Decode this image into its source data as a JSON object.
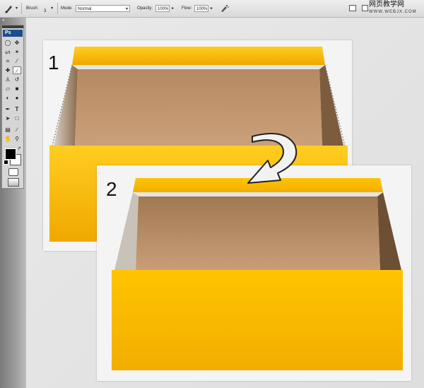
{
  "options_bar": {
    "brush_label": "Brush:",
    "brush_size": "3",
    "mode_label": "Mode:",
    "mode_value": "Normal",
    "opacity_label": "Opacity:",
    "opacity_value": "100%",
    "flow_label": "Flow:",
    "flow_value": "100%"
  },
  "watermark": {
    "text": "网页教学网",
    "url": "WWW.WEBJX.COM"
  },
  "toolbox": {
    "logo": "Ps",
    "type_tool": "T"
  },
  "steps": {
    "step1": "1",
    "step2": "2"
  },
  "colors": {
    "box_yellow": "#f7b800",
    "box_inside": "#a9805a",
    "panel_bg": "#f4f4f4"
  }
}
